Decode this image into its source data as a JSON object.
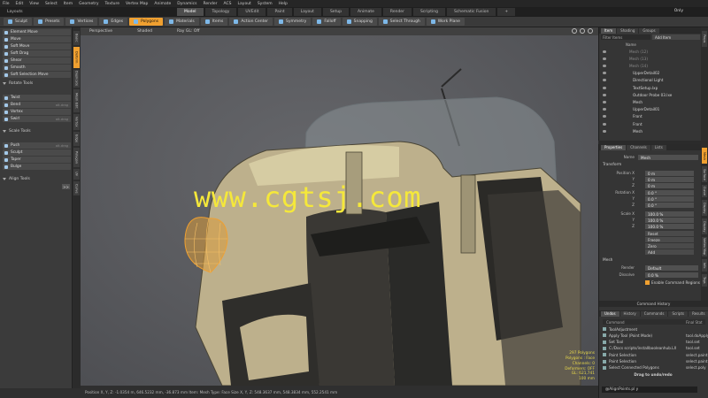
{
  "menubar": [
    "File",
    "Edit",
    "View",
    "Select",
    "Item",
    "Geometry",
    "Texture",
    "Vertex Map",
    "Animate",
    "Dynamics",
    "Render",
    "ACS",
    "Layout",
    "System",
    "Help"
  ],
  "layoutbar": {
    "label": "Layouts",
    "tabs": [
      {
        "label": "Model",
        "active": true
      },
      {
        "label": "Topology",
        "active": false
      },
      {
        "label": "UVEdit",
        "active": false
      },
      {
        "label": "Paint",
        "active": false
      },
      {
        "label": "Layout",
        "active": false
      },
      {
        "label": "Setup",
        "active": false
      },
      {
        "label": "Animate",
        "active": false
      },
      {
        "label": "Render",
        "active": false
      },
      {
        "label": "Scripting",
        "active": false
      },
      {
        "label": "Schematic Fusion",
        "active": false
      }
    ],
    "add": "+",
    "only": "Only"
  },
  "toolbar": [
    {
      "label": "Sculpt",
      "hl": false
    },
    {
      "label": "Presets",
      "hl": false
    },
    {
      "label": "Vertices",
      "hl": false
    },
    {
      "label": "Edges",
      "hl": false
    },
    {
      "label": "Polygons",
      "hl": true
    },
    {
      "label": "Materials",
      "hl": false
    },
    {
      "label": "Items",
      "hl": false
    },
    {
      "label": "Action Center",
      "hl": false
    },
    {
      "label": "Symmetry",
      "hl": false
    },
    {
      "label": "Falloff",
      "hl": false
    },
    {
      "label": "Snapping",
      "hl": false
    },
    {
      "label": "Select Through",
      "hl": false
    },
    {
      "label": "Work Plane",
      "hl": false
    }
  ],
  "left": {
    "vtabs": [
      "Basic",
      "Deform",
      "Duplicate",
      "Mesh Edit",
      "Vertex",
      "Edge",
      "Polygon",
      "UV",
      "Curve"
    ],
    "move_buttons": [
      {
        "label": "Element Move",
        "hint": ""
      },
      {
        "label": "Move",
        "hint": ""
      },
      {
        "label": "Soft Move",
        "hint": ""
      },
      {
        "label": "Soft Drag",
        "hint": ""
      },
      {
        "label": "Shear",
        "hint": ""
      },
      {
        "label": "Smooth",
        "hint": ""
      },
      {
        "label": "Soft Selection Move",
        "hint": ""
      }
    ],
    "rotate_head": "Rotate Tools",
    "rotate_buttons": [
      {
        "label": "Twist",
        "hint": ""
      },
      {
        "label": "Bend",
        "hint": "alt-drag"
      },
      {
        "label": "Vortex",
        "hint": ""
      },
      {
        "label": "Swirl",
        "hint": "alt-drag"
      }
    ],
    "scale_head": "Scale Tools",
    "scale_buttons": [
      {
        "label": "Push",
        "hint": "alt-drag"
      },
      {
        "label": "Sculpt",
        "hint": ""
      },
      {
        "label": "Taper",
        "hint": ""
      },
      {
        "label": "Bulge",
        "hint": ""
      }
    ],
    "align_head": "Align Tools",
    "more": ">>"
  },
  "viewport": {
    "header": [
      "Perspective",
      "Shaded",
      "Ray GL: Off"
    ],
    "watermark": "www.cgtsj.com",
    "stats": [
      "297 Polygons",
      "Polygons : Face",
      "Channels: 0",
      "Deformers: OFF",
      "GL: 621,741",
      "100 mm"
    ]
  },
  "status": "Position X, Y, Z:   -1.0354 m, 646.5232 mm, -36.873 mm   Item:  Mesh   Type:  Face   Size X, Y, Z:   548.3637 mm, 548.3834 mm, 552.2541 mm",
  "items": {
    "tabs": [
      {
        "label": "Item",
        "active": true
      },
      {
        "label": "Shading",
        "active": false
      },
      {
        "label": "Groups",
        "active": false
      }
    ],
    "filter": "Filter Items",
    "add": "Add Item",
    "col": "Name",
    "rows": [
      {
        "label": "Mesh (12)",
        "dim": true
      },
      {
        "label": "Mesh (13)",
        "dim": true
      },
      {
        "label": "Mesh (14)",
        "dim": true
      },
      {
        "label": "UpperDetail02",
        "dim": false
      },
      {
        "label": "Directional Light",
        "dim": false
      },
      {
        "label": "TextSetup.lxp",
        "dim": false
      },
      {
        "label": "Outdoor Probe 03.lxe",
        "dim": false
      },
      {
        "label": "Mesh",
        "dim": false
      },
      {
        "label": "UpperDetail01",
        "dim": false
      },
      {
        "label": "Front",
        "dim": false
      },
      {
        "label": "Front",
        "dim": false
      },
      {
        "label": "Mesh",
        "dim": false
      }
    ],
    "vtabs": [
      "Props"
    ]
  },
  "props": {
    "tabs": [
      {
        "label": "Properties",
        "active": true
      },
      {
        "label": "Channels",
        "active": false
      },
      {
        "label": "Lists",
        "active": false
      }
    ],
    "vtabs": [
      "Mesh",
      "Surface",
      "Curve",
      "Display",
      "Display",
      "Vertex Map",
      "Info",
      "Tags"
    ],
    "name_label": "Name",
    "name": "Mesh",
    "transform_head": "Transform",
    "position_label": "Position X",
    "rotation_label": "Rotation X",
    "scale_label": "Scale X",
    "y": "Y",
    "z": "Z",
    "position": [
      "0 m",
      "0 m",
      "0 m"
    ],
    "rotation": [
      "0.0 °",
      "0.0 °",
      "0.0 °"
    ],
    "scale": [
      "100.0 %",
      "100.0 %",
      "100.0 %"
    ],
    "actions": [
      "Reset",
      "Freeze",
      "Zero",
      "Add"
    ],
    "mesh_head": "Mesh",
    "render_label": "Render",
    "render": "Default",
    "dissolve_label": "Dissolve",
    "dissolve": "0.0 %",
    "enable_cmd": "Enable Command Regions"
  },
  "history": {
    "title": "Command History",
    "tabs": [
      {
        "label": "Undos",
        "active": true
      },
      {
        "label": "History",
        "active": false
      },
      {
        "label": "Commands",
        "active": false
      },
      {
        "label": "Scripts",
        "active": false
      },
      {
        "label": "Results",
        "active": false
      }
    ],
    "col1": "Command",
    "col2": "Final Stat",
    "rows": [
      {
        "name": "ToolAdjustment",
        "cmd": ""
      },
      {
        "name": "Apply Tool (Point Mode)",
        "cmd": "tool.doApply"
      },
      {
        "name": "Set Tool",
        "cmd": "tool.set"
      },
      {
        "name": "C:/Docs scripts/installbooleanhub.LX",
        "cmd": "tool.set"
      },
      {
        "name": "Paint Selection",
        "cmd": "select.paint"
      },
      {
        "name": "Paint Selection",
        "cmd": "select.paint"
      },
      {
        "name": "Select Connected Polygons",
        "cmd": "select.poly"
      },
      {
        "name": "Drag to undo/redo",
        "cmd": ""
      }
    ],
    "input": "@AlignPoints.pl y"
  }
}
